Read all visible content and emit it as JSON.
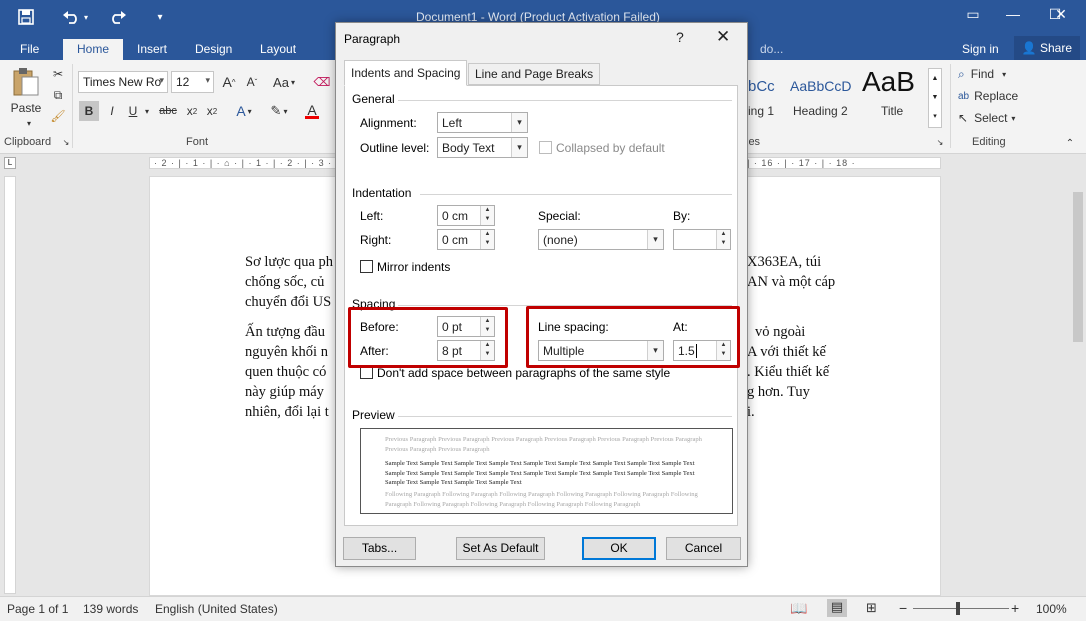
{
  "titlebar": {
    "document_title": "Document1 - Word (Product Activation Failed)",
    "save_icon": "save-icon",
    "undo_icon": "undo-icon",
    "redo_icon": "redo-icon",
    "window_controls": [
      "restore-ribbon-icon",
      "minimize-icon",
      "maximize-icon",
      "close-icon"
    ]
  },
  "tabs": {
    "items": [
      "File",
      "Home",
      "Insert",
      "Design",
      "Layout",
      "do..."
    ],
    "active": "Home",
    "sign_in": "Sign in",
    "share": "Share"
  },
  "ribbon": {
    "clipboard": {
      "paste_label": "Paste",
      "group_label": "Clipboard"
    },
    "font": {
      "font_name": "Times New Ro",
      "font_size": "12",
      "grow": "A",
      "shrink": "A",
      "case": "Aa",
      "bold": "B",
      "italic": "I",
      "underline": "U",
      "strike": "abc",
      "subscript": "x",
      "superscript": "x",
      "highlight": "A",
      "font_color": "A",
      "group_label": "Font"
    },
    "styles": {
      "items": [
        {
          "sample": "bCc",
          "name": "ing 1"
        },
        {
          "sample": "AaBbCcD",
          "name": "Heading 2"
        },
        {
          "sample": "AaB",
          "name": "Title"
        }
      ],
      "group_label": "les"
    },
    "editing": {
      "find": "Find",
      "replace": "Replace",
      "select": "Select",
      "group_label": "Editing"
    }
  },
  "ruler": {
    "text": "· 2 · | · 1 · | · ⌂ · | · 1 · | · 2 · | · 3 · | · 4 · | · 5 · | · 6 · | · 7 · | · 8 · | · 9 · | · 10 · | · 11 · | · 12 · | · 13 · | · 14 · | · 15 · | · 16 · | · 17 · | · 18 ·"
  },
  "document": {
    "left_lines": [
      "Sơ lược qua ph",
      "chống sốc, củ",
      "chuyển đổi US",
      "Ấn tượng đầu",
      "nguyên khối n",
      "quen thuộc có",
      "này giúp máy",
      "nhiên, đổi lại t"
    ],
    "right_lines": [
      "X363EA, túi",
      "AN và một cáp",
      "",
      "vỏ ngoài",
      "A với thiết kế",
      ". Kiểu thiết kế",
      "g hơn. Tuy",
      "i."
    ]
  },
  "status": {
    "page": "Page 1 of 1",
    "words": "139 words",
    "language": "English (United States)",
    "zoom_minus": "−",
    "zoom_plus": "+",
    "zoom": "100%"
  },
  "dialog": {
    "title": "Paragraph",
    "help": "?",
    "close": "✕",
    "tabs": [
      "Indents and Spacing",
      "Line and Page Breaks"
    ],
    "general": {
      "label": "General",
      "alignment_label": "Alignment:",
      "alignment_value": "Left",
      "outline_label": "Outline level:",
      "outline_value": "Body Text",
      "collapsed_label": "Collapsed by default"
    },
    "indentation": {
      "label": "Indentation",
      "left_label": "Left:",
      "left_value": "0 cm",
      "right_label": "Right:",
      "right_value": "0 cm",
      "special_label": "Special:",
      "special_value": "(none)",
      "by_label": "By:",
      "by_value": "",
      "mirror_label": "Mirror indents"
    },
    "spacing": {
      "label": "Spacing",
      "before_label": "Before:",
      "before_value": "0 pt",
      "after_label": "After:",
      "after_value": "8 pt",
      "line_spacing_label": "Line spacing:",
      "line_spacing_value": "Multiple",
      "at_label": "At:",
      "at_value": "1.5",
      "dont_add_label": "Don't add space between paragraphs of the same style"
    },
    "preview": {
      "label": "Preview",
      "previous": "Previous Paragraph Previous Paragraph Previous Paragraph Previous Paragraph Previous Paragraph Previous Paragraph Previous Paragraph Previous Paragraph",
      "sample": "Sample Text Sample Text Sample Text Sample Text Sample Text Sample Text Sample Text Sample Text Sample Text Sample Text Sample Text Sample Text Sample Text Sample Text Sample Text Sample Text Sample Text Sample Text Sample Text Sample Text Sample Text Sample Text",
      "following": "Following Paragraph Following Paragraph Following Paragraph Following Paragraph Following Paragraph Following Paragraph Following Paragraph Following Paragraph Following Paragraph Following Paragraph"
    },
    "buttons": {
      "tabs": "Tabs...",
      "set_default": "Set As Default",
      "ok": "OK",
      "cancel": "Cancel"
    },
    "highlight_color": "#c00000"
  }
}
